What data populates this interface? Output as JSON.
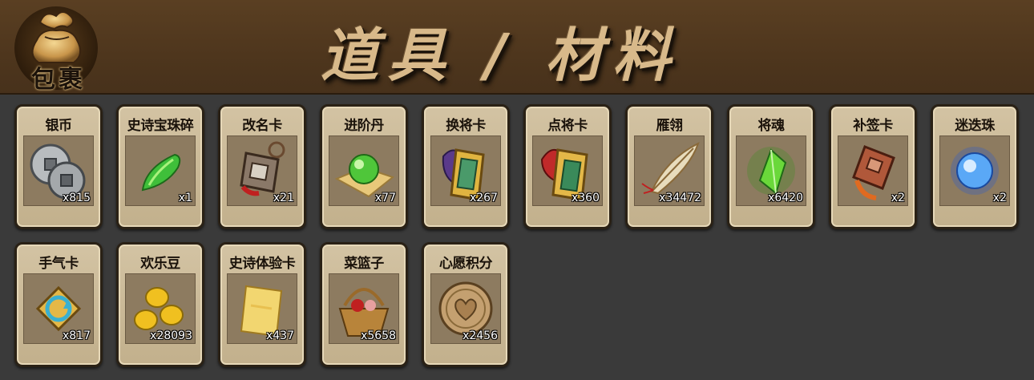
{
  "header": {
    "bag_label": "包裹",
    "title": "道具 / 材料"
  },
  "items": [
    {
      "name": "银币",
      "count": "x815",
      "icon": "silver-coin-icon"
    },
    {
      "name": "史诗宝珠碎",
      "count": "x1",
      "icon": "green-shard-icon"
    },
    {
      "name": "改名卡",
      "count": "x21",
      "icon": "rename-card-icon"
    },
    {
      "name": "进阶丹",
      "count": "x77",
      "icon": "green-pill-icon"
    },
    {
      "name": "换将卡",
      "count": "x267",
      "icon": "swap-general-card-icon"
    },
    {
      "name": "点将卡",
      "count": "x360",
      "icon": "pick-general-card-icon"
    },
    {
      "name": "雁翎",
      "count": "x34472",
      "icon": "feather-icon"
    },
    {
      "name": "将魂",
      "count": "x6420",
      "icon": "green-crystal-icon"
    },
    {
      "name": "补签卡",
      "count": "x2",
      "icon": "make-up-signin-card-icon"
    },
    {
      "name": "迷迭珠",
      "count": "x2",
      "icon": "blue-orb-icon"
    },
    {
      "name": "手气卡",
      "count": "x817",
      "icon": "luck-card-icon"
    },
    {
      "name": "欢乐豆",
      "count": "x28093",
      "icon": "gold-bean-icon"
    },
    {
      "name": "史诗体验卡",
      "count": "x437",
      "icon": "epic-trial-card-icon"
    },
    {
      "name": "菜篮子",
      "count": "x5658",
      "icon": "basket-icon"
    },
    {
      "name": "心愿积分",
      "count": "x2456",
      "icon": "heart-coin-icon"
    }
  ]
}
